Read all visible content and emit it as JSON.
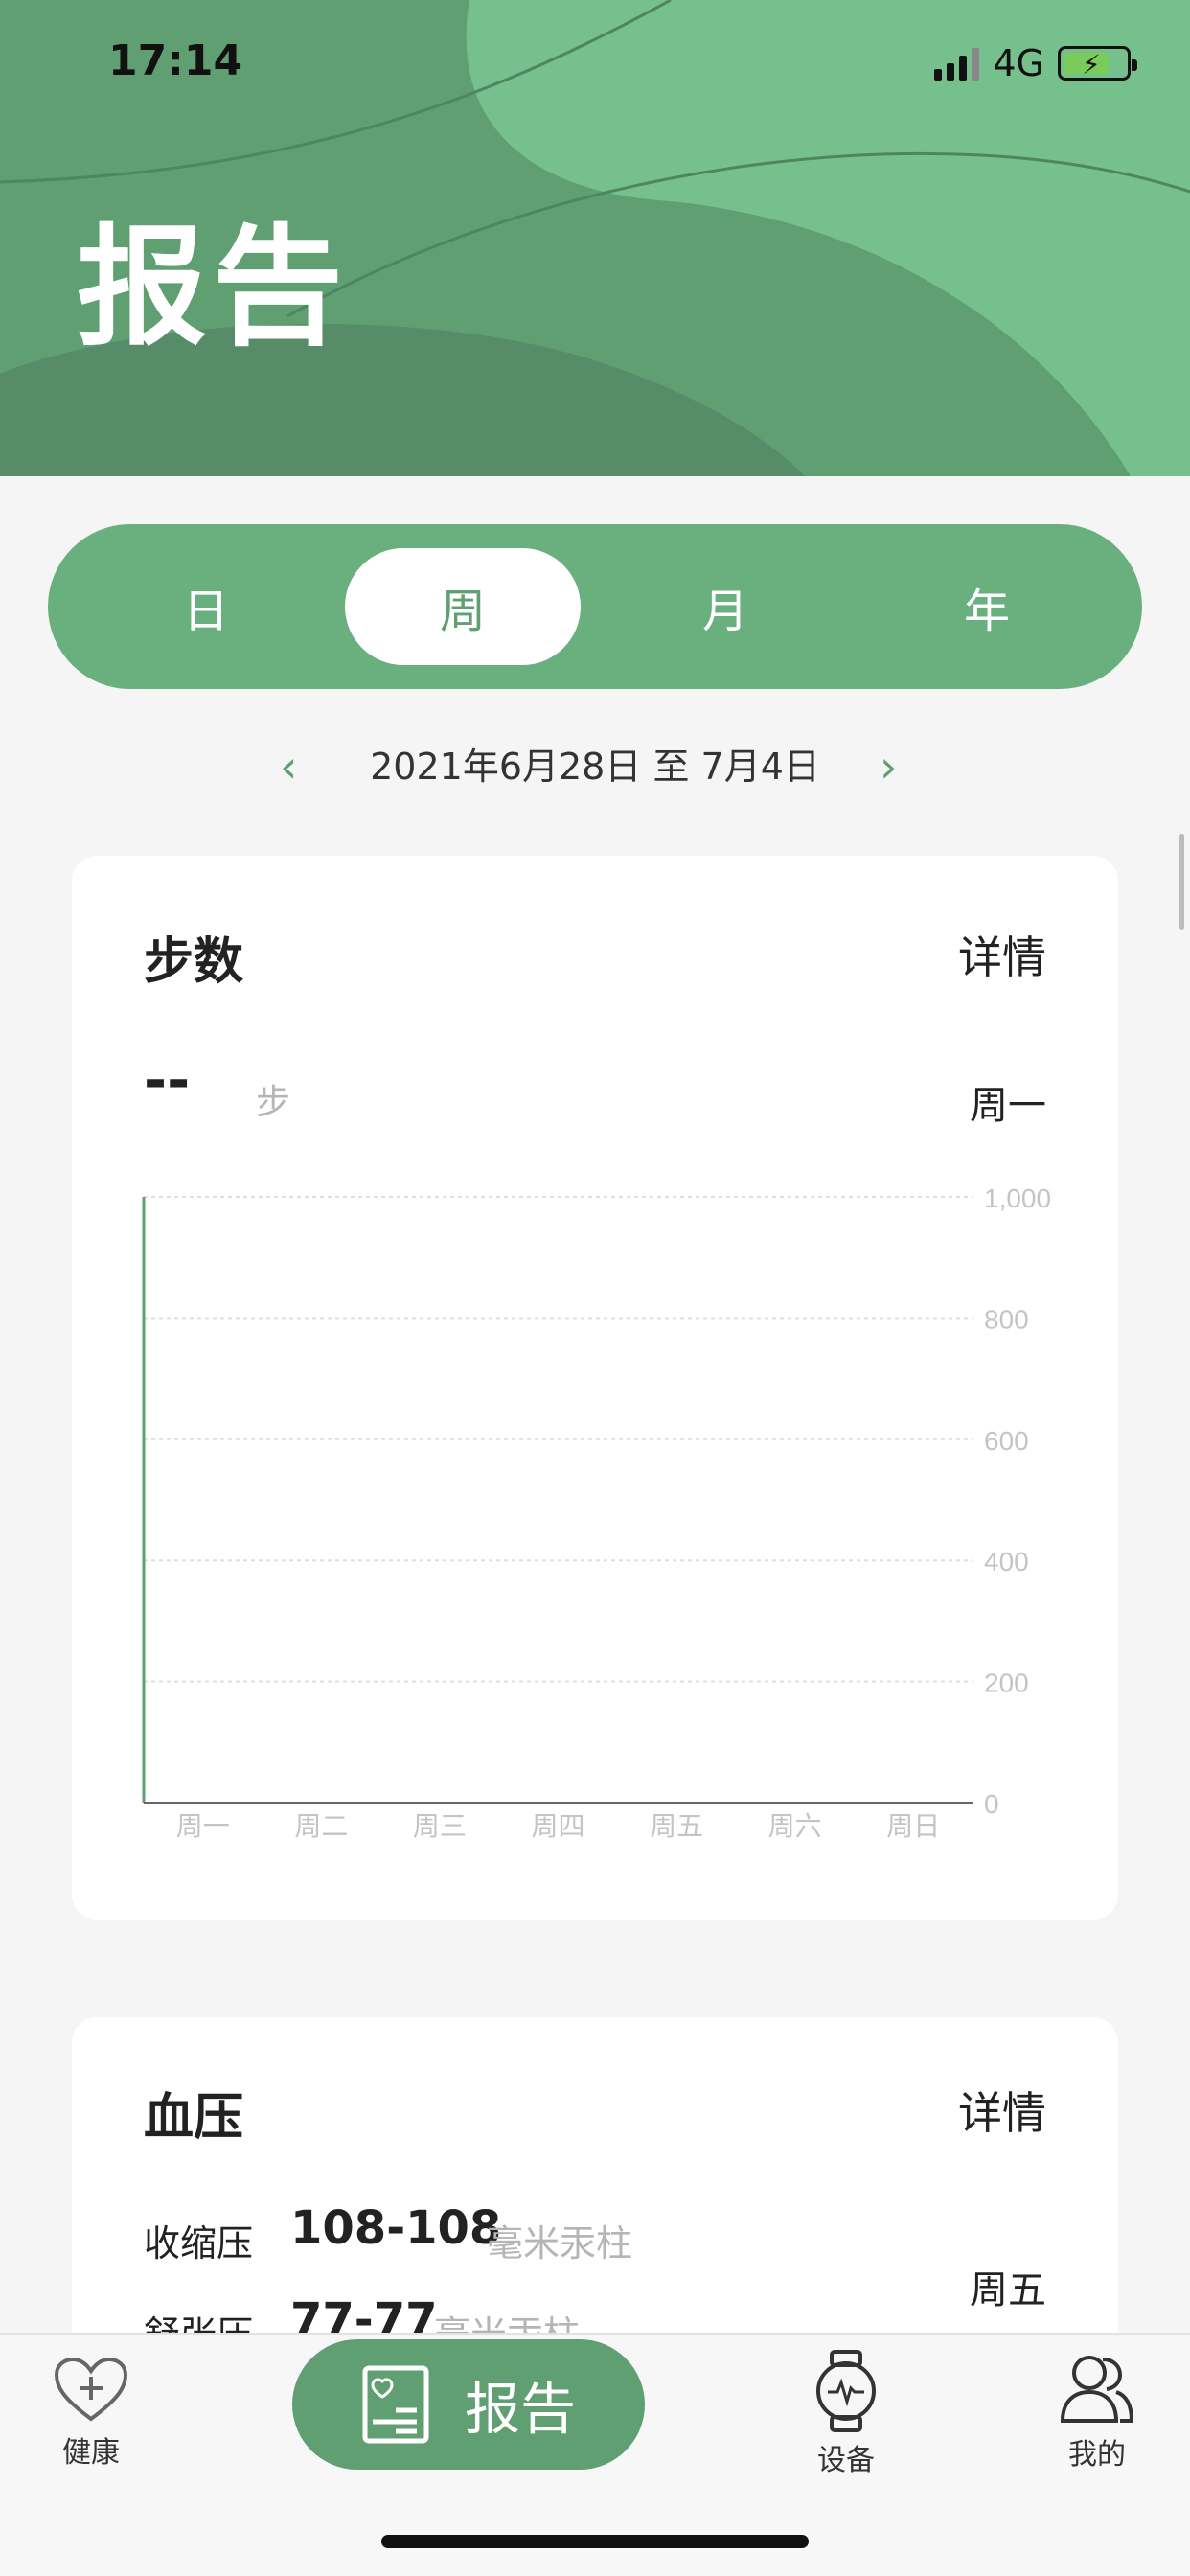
{
  "status_bar": {
    "time": "17:14",
    "network": "4G"
  },
  "header": {
    "title": "报告"
  },
  "segments": [
    {
      "label": "日",
      "active": false
    },
    {
      "label": "周",
      "active": true
    },
    {
      "label": "月",
      "active": false
    },
    {
      "label": "年",
      "active": false
    }
  ],
  "date_range": "2021年6月28日 至 7月4日",
  "steps_card": {
    "title": "步数",
    "detail": "详情",
    "value": "--",
    "unit": "步",
    "selected_day": "周一",
    "chart_data": {
      "type": "bar",
      "categories": [
        "周一",
        "周二",
        "周三",
        "周四",
        "周五",
        "周六",
        "周日"
      ],
      "values": [],
      "ylim": [
        0,
        1000
      ],
      "y_ticks": [
        "0",
        "200",
        "400",
        "600",
        "800",
        "1,000"
      ],
      "grid": true
    }
  },
  "bp_card": {
    "title": "血压",
    "detail": "详情",
    "systolic_label": "收缩压",
    "systolic_value": "108-108",
    "systolic_unit": "毫米汞柱",
    "diastolic_label": "舒张压",
    "diastolic_value": "77-77",
    "diastolic_unit": "毫米汞柱",
    "selected_day": "周五"
  },
  "tabbar": {
    "health": "健康",
    "report": "报告",
    "device": "设备",
    "mine": "我的"
  },
  "colors": {
    "accent": "#5f9f72",
    "accent_light": "#76c08e",
    "segment_bg": "#6ab07f"
  }
}
